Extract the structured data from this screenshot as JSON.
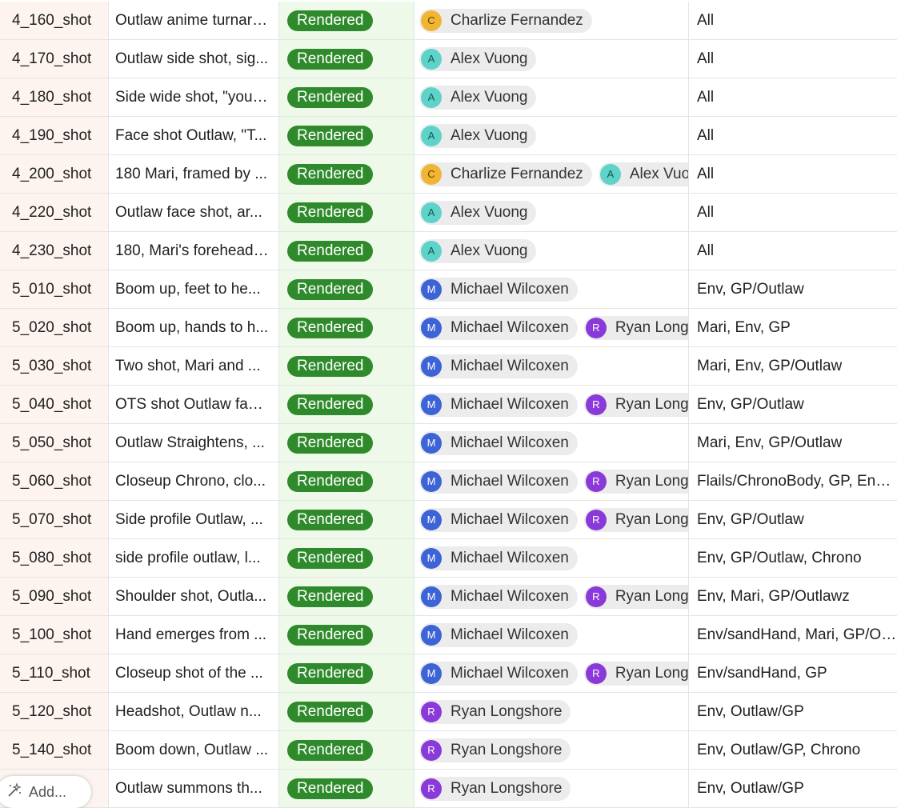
{
  "colors": {
    "status_rendered": "#2f8a2c",
    "avatar_C": "#f1b534",
    "avatar_A": "#5fd3c9",
    "avatar_M": "#3d64d6",
    "avatar_R": "#8a3ad8"
  },
  "add_button": {
    "label": "Add...",
    "icon": "magic-wand-icon"
  },
  "rows": [
    {
      "name": "4_160_shot",
      "desc": "Outlaw anime turnaround",
      "status": "Rendered",
      "people": [
        {
          "initial": "C",
          "name": "Charlize Fernandez"
        }
      ],
      "assets": "All"
    },
    {
      "name": "4_170_shot",
      "desc": "Outlaw side shot, sig...",
      "status": "Rendered",
      "people": [
        {
          "initial": "A",
          "name": "Alex Vuong"
        }
      ],
      "assets": "All"
    },
    {
      "name": "4_180_shot",
      "desc": "Side wide shot, \"you ...",
      "status": "Rendered",
      "people": [
        {
          "initial": "A",
          "name": "Alex Vuong"
        }
      ],
      "assets": "All"
    },
    {
      "name": "4_190_shot",
      "desc": "Face shot Outlaw, \"T...",
      "status": "Rendered",
      "people": [
        {
          "initial": "A",
          "name": "Alex Vuong"
        }
      ],
      "assets": "All"
    },
    {
      "name": "4_200_shot",
      "desc": "180 Mari, framed by ...",
      "status": "Rendered",
      "people": [
        {
          "initial": "C",
          "name": "Charlize Fernandez"
        },
        {
          "initial": "A",
          "name": "Alex Vuong"
        }
      ],
      "assets": "All"
    },
    {
      "name": "4_220_shot",
      "desc": "Outlaw face shot, ar...",
      "status": "Rendered",
      "people": [
        {
          "initial": "A",
          "name": "Alex Vuong"
        }
      ],
      "assets": "All"
    },
    {
      "name": "4_230_shot",
      "desc": "180, Mari's forehead,...",
      "status": "Rendered",
      "people": [
        {
          "initial": "A",
          "name": "Alex Vuong"
        }
      ],
      "assets": "All"
    },
    {
      "name": "5_010_shot",
      "desc": "Boom up, feet to he...",
      "status": "Rendered",
      "people": [
        {
          "initial": "M",
          "name": "Michael Wilcoxen"
        }
      ],
      "assets": "Env, GP/Outlaw"
    },
    {
      "name": "5_020_shot",
      "desc": "Boom up, hands to h...",
      "status": "Rendered",
      "people": [
        {
          "initial": "M",
          "name": "Michael Wilcoxen"
        },
        {
          "initial": "R",
          "name": "Ryan Longshore"
        }
      ],
      "assets": "Mari, Env, GP"
    },
    {
      "name": "5_030_shot",
      "desc": "Two shot, Mari and ...",
      "status": "Rendered",
      "people": [
        {
          "initial": "M",
          "name": "Michael Wilcoxen"
        }
      ],
      "assets": "Mari, Env, GP/Outlaw"
    },
    {
      "name": "5_040_shot",
      "desc": "OTS shot Outlaw faci...",
      "status": "Rendered",
      "people": [
        {
          "initial": "M",
          "name": "Michael Wilcoxen"
        },
        {
          "initial": "R",
          "name": "Ryan Longshore"
        }
      ],
      "assets": "Env, GP/Outlaw"
    },
    {
      "name": "5_050_shot",
      "desc": "Outlaw Straightens, ...",
      "status": "Rendered",
      "people": [
        {
          "initial": "M",
          "name": "Michael Wilcoxen"
        }
      ],
      "assets": "Mari, Env, GP/Outlaw"
    },
    {
      "name": "5_060_shot",
      "desc": "Closeup Chrono, clo...",
      "status": "Rendered",
      "people": [
        {
          "initial": "M",
          "name": "Michael Wilcoxen"
        },
        {
          "initial": "R",
          "name": "Ryan Longshore"
        }
      ],
      "assets": "Flails/ChronoBody, GP, Env, Mari"
    },
    {
      "name": "5_070_shot",
      "desc": "Side profile Outlaw, ...",
      "status": "Rendered",
      "people": [
        {
          "initial": "M",
          "name": "Michael Wilcoxen"
        },
        {
          "initial": "R",
          "name": "Ryan Longshore"
        }
      ],
      "assets": "Env, GP/Outlaw"
    },
    {
      "name": "5_080_shot",
      "desc": "side profile outlaw, l...",
      "status": "Rendered",
      "people": [
        {
          "initial": "M",
          "name": "Michael Wilcoxen"
        }
      ],
      "assets": "Env, GP/Outlaw, Chrono"
    },
    {
      "name": "5_090_shot",
      "desc": "Shoulder shot, Outla...",
      "status": "Rendered",
      "people": [
        {
          "initial": "M",
          "name": "Michael Wilcoxen"
        },
        {
          "initial": "R",
          "name": "Ryan Longshore"
        }
      ],
      "assets": "Env, Mari, GP/Outlawz"
    },
    {
      "name": "5_100_shot",
      "desc": "Hand emerges from ...",
      "status": "Rendered",
      "people": [
        {
          "initial": "M",
          "name": "Michael Wilcoxen"
        }
      ],
      "assets": "Env/sandHand, Mari, GP/Outlaw"
    },
    {
      "name": "5_110_shot",
      "desc": "Closeup shot of the ...",
      "status": "Rendered",
      "people": [
        {
          "initial": "M",
          "name": "Michael Wilcoxen"
        },
        {
          "initial": "R",
          "name": "Ryan Longshore"
        }
      ],
      "assets": "Env/sandHand, GP"
    },
    {
      "name": "5_120_shot",
      "desc": "Headshot, Outlaw n...",
      "status": "Rendered",
      "people": [
        {
          "initial": "R",
          "name": "Ryan Longshore"
        }
      ],
      "assets": "Env, Outlaw/GP"
    },
    {
      "name": "5_140_shot",
      "desc": "Boom down, Outlaw ...",
      "status": "Rendered",
      "people": [
        {
          "initial": "R",
          "name": "Ryan Longshore"
        }
      ],
      "assets": "Env, Outlaw/GP, Chrono"
    },
    {
      "name": "",
      "desc": "Outlaw summons th...",
      "status": "Rendered",
      "people": [
        {
          "initial": "R",
          "name": "Ryan Longshore"
        }
      ],
      "assets": "Env, Outlaw/GP"
    }
  ]
}
